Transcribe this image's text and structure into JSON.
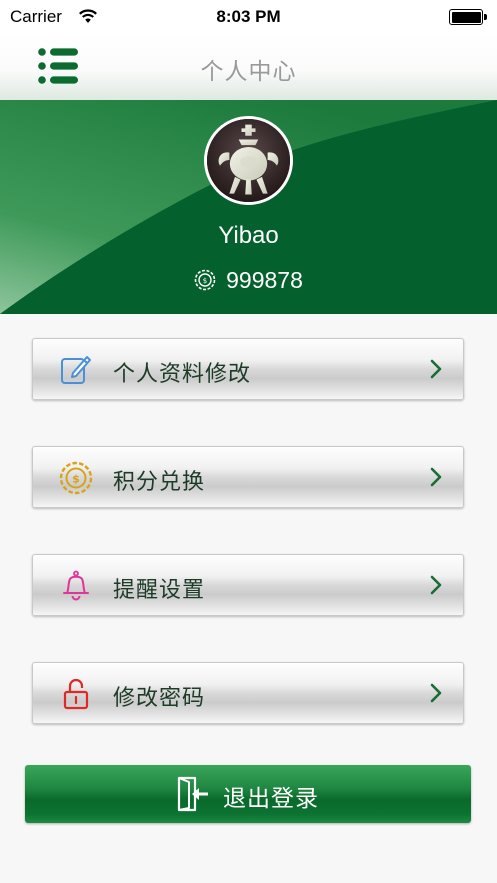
{
  "status_bar": {
    "carrier": "Carrier",
    "time": "8:03 PM"
  },
  "nav": {
    "title": "个人中心",
    "menu_icon": "list-menu-icon"
  },
  "profile": {
    "username": "Yibao",
    "points": "999878",
    "points_icon": "coin-icon",
    "avatar": "jade-censer-avatar"
  },
  "menu": {
    "items": [
      {
        "label": "个人资料修改",
        "icon": "edit-icon",
        "icon_color": "#4a90d9"
      },
      {
        "label": "积分兑换",
        "icon": "coin-exchange-icon",
        "icon_color": "#d9a21a"
      },
      {
        "label": "提醒设置",
        "icon": "bell-icon",
        "icon_color": "#e0359a"
      },
      {
        "label": "修改密码",
        "icon": "unlock-icon",
        "icon_color": "#e02828"
      }
    ]
  },
  "logout": {
    "label": "退出登录",
    "icon": "logout-door-icon"
  },
  "colors": {
    "brand_green": "#04612d",
    "chevron_green": "#1a6b35"
  }
}
